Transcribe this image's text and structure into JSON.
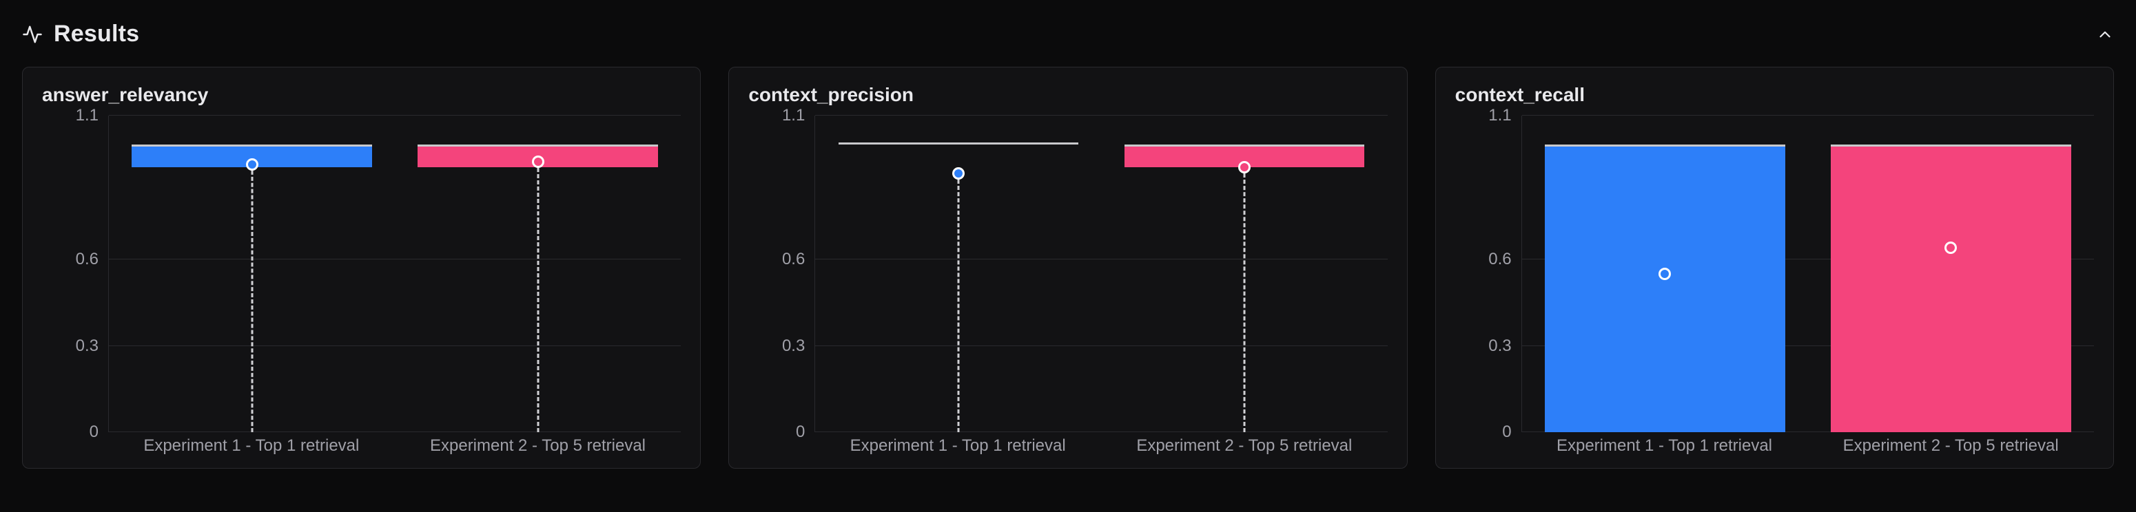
{
  "header": {
    "title": "Results"
  },
  "chart_data": [
    {
      "type": "bar",
      "title": "answer_relevancy",
      "categories": [
        "Experiment 1 - Top 1 retrieval",
        "Experiment 2 - Top 5 retrieval"
      ],
      "series_colors": [
        "#2d7ff9",
        "#f4447c"
      ],
      "bar_top": [
        1.0,
        1.0
      ],
      "bar_bottom": [
        0.92,
        0.92
      ],
      "marker": [
        0.93,
        0.94
      ],
      "stem_to_zero": true,
      "marker_filled": true,
      "ylim": [
        0,
        1.1
      ],
      "yticks": [
        0,
        0.3,
        0.6,
        1.1
      ],
      "ytick_labels": [
        "0",
        "0.3",
        "0.6",
        "1.1"
      ]
    },
    {
      "type": "bar",
      "title": "context_precision",
      "categories": [
        "Experiment 1 - Top 1 retrieval",
        "Experiment 2 - Top 5 retrieval"
      ],
      "series_colors": [
        "#2d7ff9",
        "#f4447c"
      ],
      "bar_top": [
        1.0,
        1.0
      ],
      "bar_bottom": [
        1.0,
        0.92
      ],
      "marker": [
        0.9,
        0.92
      ],
      "stem_to_zero": true,
      "marker_filled": true,
      "ylim": [
        0,
        1.1
      ],
      "yticks": [
        0,
        0.3,
        0.6,
        1.1
      ],
      "ytick_labels": [
        "0",
        "0.3",
        "0.6",
        "1.1"
      ]
    },
    {
      "type": "bar",
      "title": "context_recall",
      "categories": [
        "Experiment 1 - Top 1 retrieval",
        "Experiment 2 - Top 5 retrieval"
      ],
      "series_colors": [
        "#2d7ff9",
        "#f4447c"
      ],
      "bar_top": [
        1.0,
        1.0
      ],
      "bar_bottom": [
        0.0,
        0.0
      ],
      "marker": [
        0.55,
        0.64
      ],
      "stem_to_zero": false,
      "marker_filled": false,
      "ylim": [
        0,
        1.1
      ],
      "yticks": [
        0,
        0.3,
        0.6,
        1.1
      ],
      "ytick_labels": [
        "0",
        "0.3",
        "0.6",
        "1.1"
      ]
    }
  ]
}
